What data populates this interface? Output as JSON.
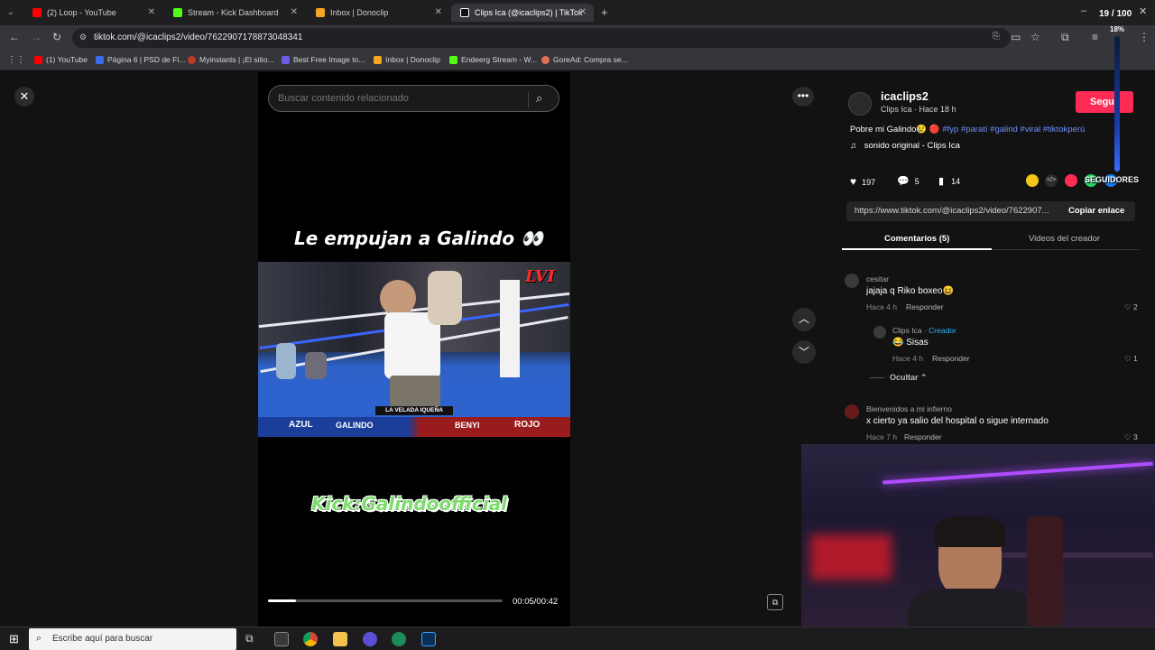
{
  "tabs": [
    {
      "title": "(2) Loop - YouTube",
      "color": "#ff0000"
    },
    {
      "title": "Stream - Kick Dashboard",
      "color": "#53fc18"
    },
    {
      "title": "Inbox | Donoclip",
      "color": "#f5a623"
    },
    {
      "title": "Clips Ica (@icaclips2) | TikTok",
      "color": "#ffffff"
    }
  ],
  "address": {
    "url": "tiktok.com/@icaclips2/video/7622907178873048341"
  },
  "bookmarks": [
    {
      "label": "(1) YouTube",
      "color": "#ff0000"
    },
    {
      "label": "Página 6 | PSD de Fl...",
      "color": "#3b6cf0"
    },
    {
      "label": "Myinstants | ¡El sitio...",
      "color": "#c0392b"
    },
    {
      "label": "Best Free Image to...",
      "color": "#6c5ce7"
    },
    {
      "label": "Inbox | Donoclip",
      "color": "#f5a623"
    },
    {
      "label": "Endeerg Stream - W...",
      "color": "#53fc18"
    },
    {
      "label": "GoreAd: Compra se...",
      "color": "#e17055"
    }
  ],
  "overlay": {
    "clock": "19 / 100",
    "percent": "18%",
    "segui_label": "SEGUIDORES"
  },
  "video": {
    "search_placeholder": "Buscar contenido relacionado",
    "top_caption": "Le empujan a Galindo 👀",
    "bottom_caption": "Kick:Galindoofficial",
    "scoreboard": {
      "event": "LA VELADA IQUEÑA",
      "left": "AZUL",
      "name1": "GALINDO",
      "name2": "BENYI",
      "right": "ROJO"
    },
    "watermark": "LVI",
    "time": "00:05/00:42",
    "progress": 0.12
  },
  "post": {
    "username": "icaclips2",
    "subline": "Clips Ica · Hace 18 h",
    "follow_label": "Segu",
    "description": "Pobre mi Galindo😢 🔴",
    "hashtags": "#fyp #paratí #galind #viral #tiktokperú",
    "sound": "sonido original - Clips Ica",
    "likes": "197",
    "comments": "5",
    "saves": "14",
    "link": "https://www.tiktok.com/@icaclips2/video/7622907...",
    "copy_label": "Copiar enlace",
    "tab_comments": "Comentarios (5)",
    "tab_creator": "Videos del creador"
  },
  "comments_list": [
    {
      "user": "cesitar",
      "text": "jajaja q Riko boxeo😆",
      "time": "Hace 4 h",
      "reply": "Responder",
      "likes": "2"
    },
    {
      "user": "Clips Ica",
      "creator_tag": "· Creador",
      "text": "😂 Sisas",
      "time": "Hace 4 h",
      "reply": "Responder",
      "likes": "1",
      "hide_label": "Ocultar"
    },
    {
      "user": "Bienvenidos a mi infierno",
      "text": "x cierto ya salio del hospital o sigue internado",
      "time": "Hace 7 h",
      "reply": "Responder",
      "likes": "3"
    }
  ],
  "taskbar": {
    "search_placeholder": "Escribe aquí para buscar"
  },
  "colors": {
    "accent": "#fe2c55",
    "hashtag": "#6f8fff",
    "creator": "#31b4ff"
  }
}
